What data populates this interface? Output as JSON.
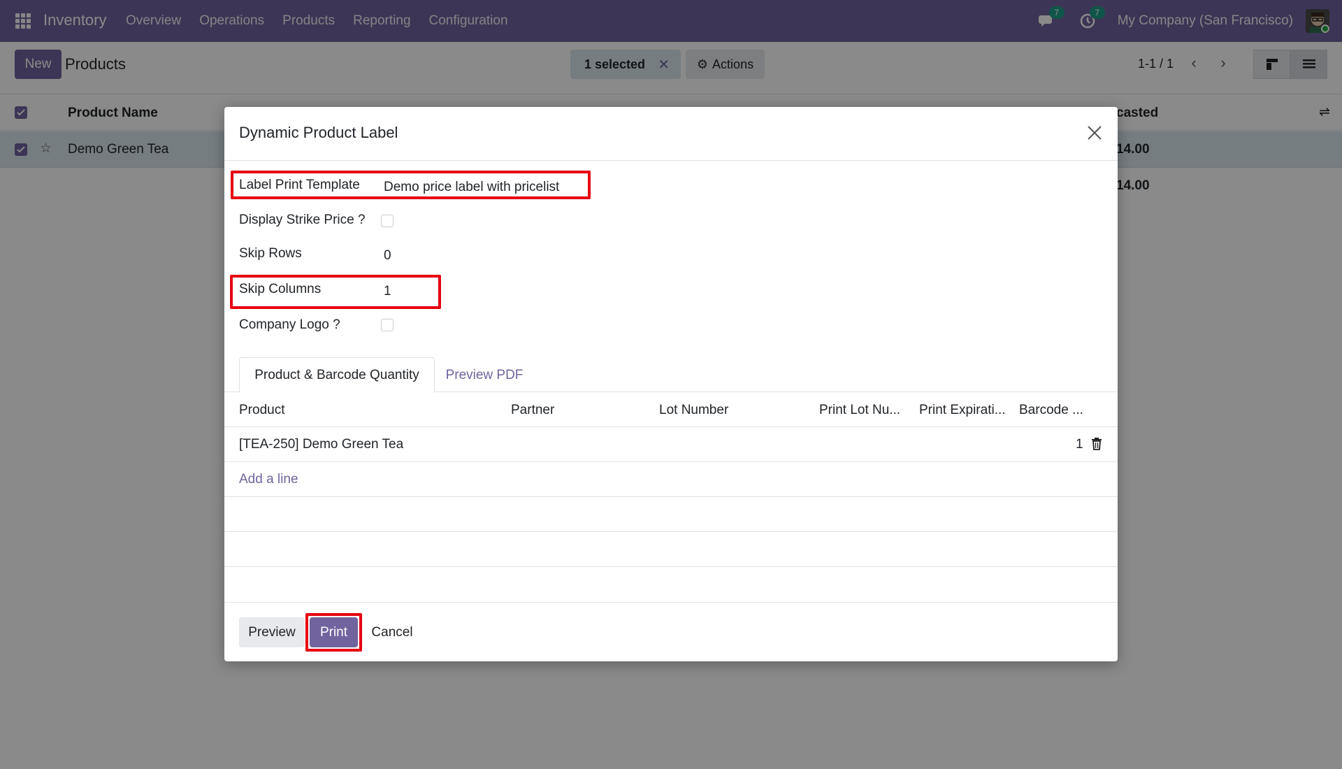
{
  "navbar": {
    "brand": "Inventory",
    "menu": [
      "Overview",
      "Operations",
      "Products",
      "Reporting",
      "Configuration"
    ],
    "messages_badge": "7",
    "activities_badge": "7",
    "company": "My Company (San Francisco)",
    "accent_color": "#71639e"
  },
  "control": {
    "new_label": "New",
    "breadcrumb": "Products",
    "selected_label": "1 selected",
    "actions_label": "Actions",
    "pager": "1-1 / 1"
  },
  "list": {
    "header_product_name": "Product Name",
    "header_forecasted_partial": "casted",
    "row_product": "Demo Green Tea",
    "row_forecast": "14.00",
    "total_forecast": "14.00"
  },
  "modal": {
    "title": "Dynamic Product Label",
    "fields": {
      "label_print_template": {
        "label": "Label Print Template",
        "value": "Demo price label with pricelist"
      },
      "display_strike_price": {
        "label": "Display Strike Price ?",
        "checked": false
      },
      "skip_rows": {
        "label": "Skip Rows",
        "value": "0"
      },
      "skip_columns": {
        "label": "Skip Columns",
        "value": "1"
      },
      "company_logo": {
        "label": "Company Logo ?",
        "checked": false
      }
    },
    "tabs": [
      "Product & Barcode Quantity",
      "Preview PDF"
    ],
    "table": {
      "columns": [
        "Product",
        "Partner",
        "Lot Number",
        "Print Lot Nu...",
        "Print Expirati...",
        "Barcode ..."
      ],
      "rows": [
        {
          "product": "[TEA-250] Demo Green Tea",
          "partner": "",
          "lot_number": "",
          "barcode_qty": "1"
        }
      ],
      "add_line": "Add a line"
    },
    "footer": {
      "preview_label": "Preview",
      "print_label": "Print",
      "cancel_label": "Cancel"
    },
    "highlight_color": "#e60012"
  }
}
